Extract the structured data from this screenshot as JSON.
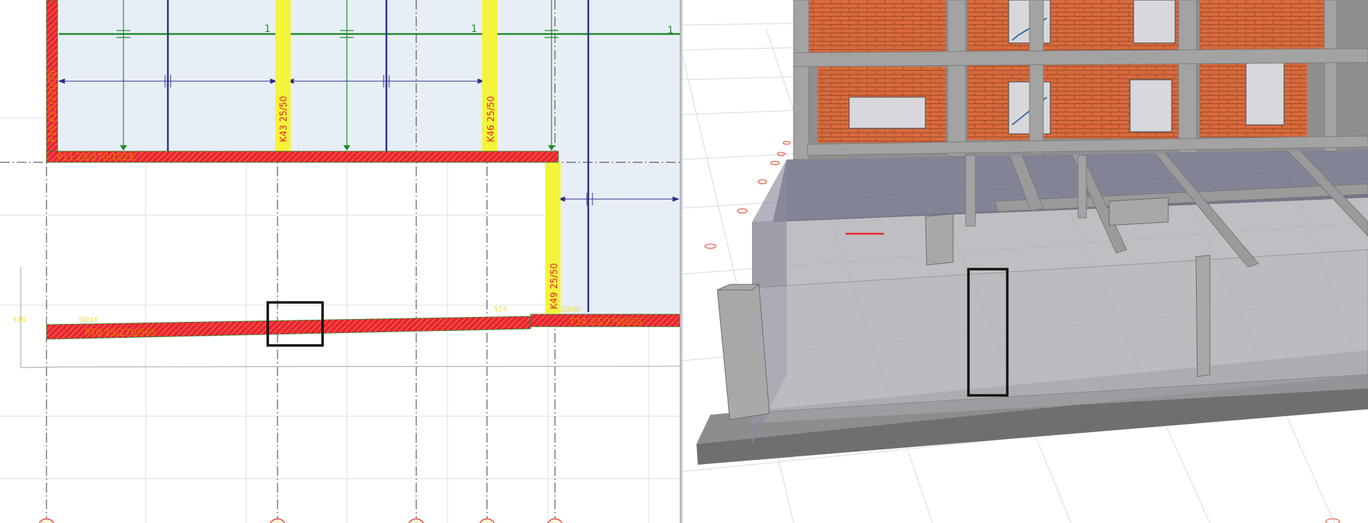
{
  "plan": {
    "grid_marks": [
      "1",
      "1",
      "1"
    ],
    "labels": {
      "p16": "P16 A25/270/70",
      "p11": "P11 25/270/1025",
      "k43": "K43 25/50",
      "k46": "K46 25/50",
      "k49": "K49 25/50",
      "p70": "P70 25/270/565",
      "p14": "P14 25/270/665",
      "dim_left": "330",
      "dim_mid": "50/16",
      "dim_524": "524",
      "dim_k49": "20/20"
    },
    "colors": {
      "wall_hatch": "#e8252e",
      "column_yellow": "#f4f43a",
      "slab_fill": "#e8eef6",
      "beam_navy": "#27308c",
      "axis_green": "#1f8a2a",
      "label_orange": "#e07a00"
    }
  },
  "view3d": {
    "colors": {
      "brick": "#d86a3c",
      "concrete": "#9a9a9a",
      "glass": "#5f6279"
    }
  }
}
